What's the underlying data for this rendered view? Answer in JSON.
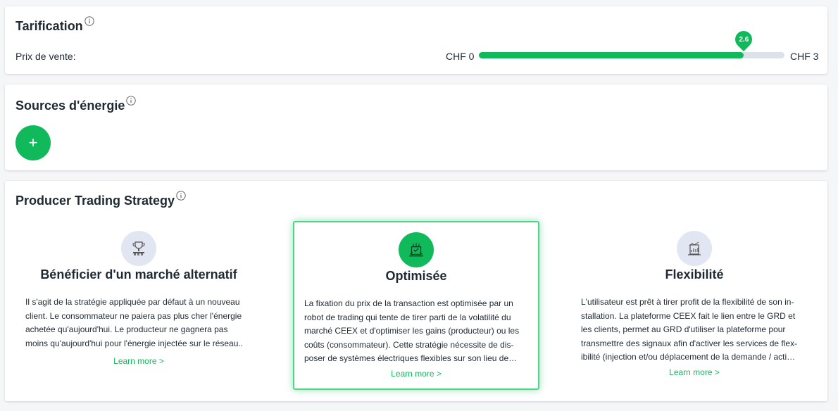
{
  "colors": {
    "accent": "#10b95a",
    "track": "#dde1ea",
    "icon_bg": "#e2e6f3",
    "text": "#1f2933"
  },
  "tarification": {
    "title": "Tarification",
    "info_icon": "info-icon",
    "price_label": "Prix de vente:",
    "slider": {
      "min_label": "CHF 0",
      "max_label": "CHF 3",
      "value": 2.6,
      "value_label": "2.6",
      "min": 0,
      "max": 3
    }
  },
  "sources": {
    "title": "Sources d'énergie",
    "info_icon": "info-icon",
    "add_button_label": "+",
    "add_icon": "plus-icon"
  },
  "strategy": {
    "title": "Producer Trading Strategy",
    "info_icon": "info-icon",
    "options": [
      {
        "title": "Bénéficier d'un marché alternatif",
        "icon": "trophy-icon",
        "description": "Il s'agit de la stratégie appliquée par défaut à un nouveau client. Le consommateur ne paiera pas plus cher l'énergie achetée qu'aujourd'hui. Le producteur ne gagnera pas moins qu'aujourd'hui pour l'énergie injectée sur le réseau..",
        "link": "Learn more >",
        "selected": false
      },
      {
        "title": "Optimisée",
        "icon": "trading-robot-icon",
        "description": "La fixation du prix de la transaction est optimisée par un robot de trading qui tente de tirer parti de la volatilité du marché CEEX et d'optimiser les gains (producteur) ou les coûts (consommateur). Cette stratégie nécessite de dis-poser de systèmes électriques flexibles sur son lieu de…",
        "link": "Learn more >",
        "selected": true
      },
      {
        "title": "Flexibilité",
        "icon": "flexibility-chart-icon",
        "description": "L'utilisateur est prêt à tirer profit de la flexibilité de son in-stallation. La plateforme CEEX fait le lien entre le GRD et les clients, permet au GRD d'utiliser la plateforme pour transmettre des signaux afin d'activer les services de flex-ibilité (injection et/ou déplacement de la demande / acti…",
        "link": "Learn more >",
        "selected": false
      }
    ]
  }
}
